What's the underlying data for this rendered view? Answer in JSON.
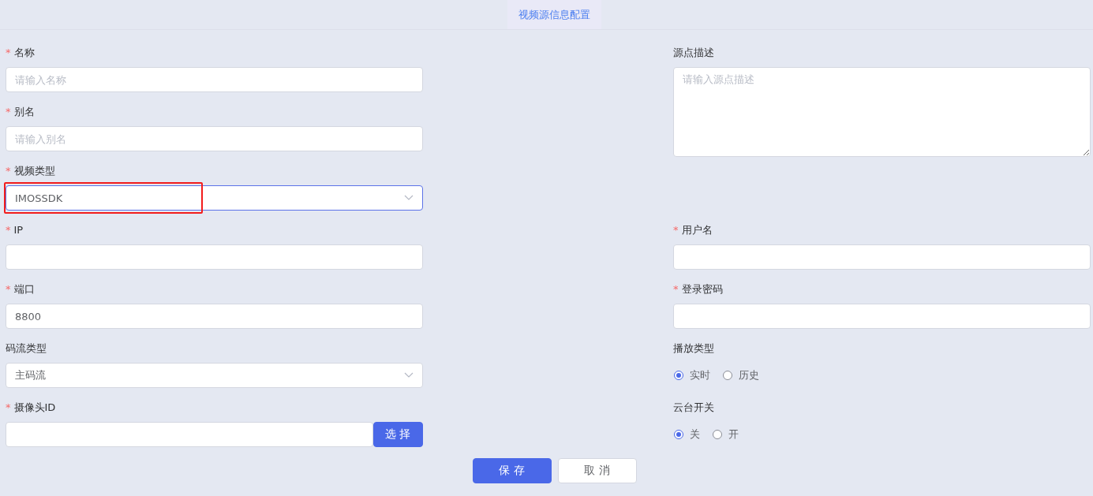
{
  "header": {
    "title": "视频源信息配置"
  },
  "left_fields": [
    {
      "kind": "text",
      "marker": "*",
      "label": "名称",
      "placeholder": "请输入名称"
    },
    {
      "kind": "text",
      "marker": "*",
      "label": "别名",
      "placeholder": "请输入别名"
    },
    {
      "kind": "select",
      "marker": "*",
      "label": "视频类型",
      "value": "IMOSSDK",
      "focused": true,
      "highlighted": true
    },
    {
      "kind": "text",
      "marker": "*",
      "label": "IP"
    },
    {
      "kind": "text",
      "marker": "*",
      "label": "端口",
      "value": "8800"
    },
    {
      "kind": "select",
      "label": "码流类型",
      "value": "主码流",
      "focused": false
    },
    {
      "kind": "picker",
      "marker": "*",
      "label": "摄像头ID",
      "button": "选 择"
    }
  ],
  "right_fields": [
    {
      "kind": "textarea",
      "label": "源点描述",
      "placeholder": "请输入源点描述"
    },
    {
      "kind": "text",
      "marker": "*",
      "label": "用户名"
    },
    {
      "kind": "text",
      "marker": "*",
      "label": "登录密码"
    },
    {
      "kind": "radio",
      "label": "播放类型",
      "options": [
        {
          "label": "实时",
          "selected": true
        },
        {
          "label": "历史",
          "selected": false
        }
      ]
    },
    {
      "kind": "radio",
      "label": "云台开关",
      "options": [
        {
          "label": "关",
          "selected": true
        },
        {
          "label": "开",
          "selected": false
        }
      ]
    }
  ],
  "buttons": [
    {
      "kind": "primary",
      "label": "保 存"
    },
    {
      "kind": "default",
      "label": "取 消"
    }
  ]
}
